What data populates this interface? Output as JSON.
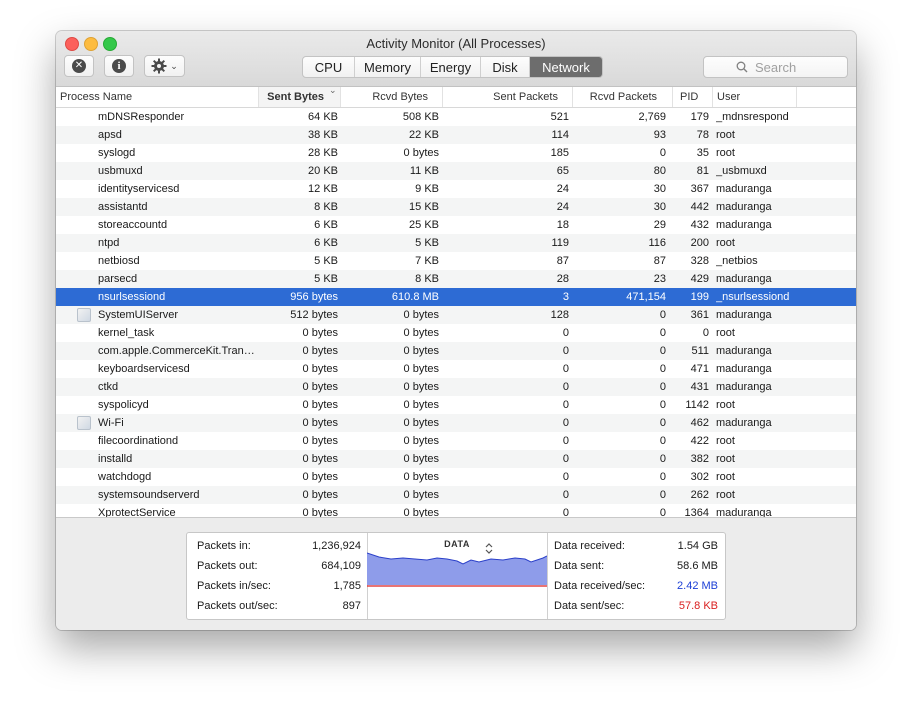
{
  "window": {
    "title": "Activity Monitor (All Processes)"
  },
  "toolbar": {
    "stop_icon": "x-circle-icon",
    "info_icon": "info-circle-icon",
    "gear_icon": "gear-icon",
    "tabs": [
      {
        "label": "CPU",
        "active": false
      },
      {
        "label": "Memory",
        "active": false
      },
      {
        "label": "Energy",
        "active": false
      },
      {
        "label": "Disk",
        "active": false
      },
      {
        "label": "Network",
        "active": true
      }
    ],
    "search_placeholder": "Search"
  },
  "table": {
    "columns": [
      "Process Name",
      "Sent Bytes",
      "Rcvd Bytes",
      "Sent Packets",
      "Rcvd Packets",
      "PID",
      "User"
    ],
    "sort_indicator": "⌄",
    "rows": [
      {
        "name": "mDNSResponder",
        "sent_bytes": "64 KB",
        "rcvd_bytes": "508 KB",
        "sent_packets": "521",
        "rcvd_packets": "2,769",
        "pid": "179",
        "user": "_mdnsrespond",
        "icon": false,
        "selected": false
      },
      {
        "name": "apsd",
        "sent_bytes": "38 KB",
        "rcvd_bytes": "22 KB",
        "sent_packets": "114",
        "rcvd_packets": "93",
        "pid": "78",
        "user": "root",
        "icon": false,
        "selected": false
      },
      {
        "name": "syslogd",
        "sent_bytes": "28 KB",
        "rcvd_bytes": "0 bytes",
        "sent_packets": "185",
        "rcvd_packets": "0",
        "pid": "35",
        "user": "root",
        "icon": false,
        "selected": false
      },
      {
        "name": "usbmuxd",
        "sent_bytes": "20 KB",
        "rcvd_bytes": "11 KB",
        "sent_packets": "65",
        "rcvd_packets": "80",
        "pid": "81",
        "user": "_usbmuxd",
        "icon": false,
        "selected": false
      },
      {
        "name": "identityservicesd",
        "sent_bytes": "12 KB",
        "rcvd_bytes": "9 KB",
        "sent_packets": "24",
        "rcvd_packets": "30",
        "pid": "367",
        "user": "maduranga",
        "icon": false,
        "selected": false
      },
      {
        "name": "assistantd",
        "sent_bytes": "8 KB",
        "rcvd_bytes": "15 KB",
        "sent_packets": "24",
        "rcvd_packets": "30",
        "pid": "442",
        "user": "maduranga",
        "icon": false,
        "selected": false
      },
      {
        "name": "storeaccountd",
        "sent_bytes": "6 KB",
        "rcvd_bytes": "25 KB",
        "sent_packets": "18",
        "rcvd_packets": "29",
        "pid": "432",
        "user": "maduranga",
        "icon": false,
        "selected": false
      },
      {
        "name": "ntpd",
        "sent_bytes": "6 KB",
        "rcvd_bytes": "5 KB",
        "sent_packets": "119",
        "rcvd_packets": "116",
        "pid": "200",
        "user": "root",
        "icon": false,
        "selected": false
      },
      {
        "name": "netbiosd",
        "sent_bytes": "5 KB",
        "rcvd_bytes": "7 KB",
        "sent_packets": "87",
        "rcvd_packets": "87",
        "pid": "328",
        "user": "_netbios",
        "icon": false,
        "selected": false
      },
      {
        "name": "parsecd",
        "sent_bytes": "5 KB",
        "rcvd_bytes": "8 KB",
        "sent_packets": "28",
        "rcvd_packets": "23",
        "pid": "429",
        "user": "maduranga",
        "icon": false,
        "selected": false
      },
      {
        "name": "nsurlsessiond",
        "sent_bytes": "956 bytes",
        "rcvd_bytes": "610.8 MB",
        "sent_packets": "3",
        "rcvd_packets": "471,154",
        "pid": "199",
        "user": "_nsurlsessiond",
        "icon": false,
        "selected": true
      },
      {
        "name": "SystemUIServer",
        "sent_bytes": "512 bytes",
        "rcvd_bytes": "0 bytes",
        "sent_packets": "128",
        "rcvd_packets": "0",
        "pid": "361",
        "user": "maduranga",
        "icon": true,
        "selected": false
      },
      {
        "name": "kernel_task",
        "sent_bytes": "0 bytes",
        "rcvd_bytes": "0 bytes",
        "sent_packets": "0",
        "rcvd_packets": "0",
        "pid": "0",
        "user": "root",
        "icon": false,
        "selected": false
      },
      {
        "name": "com.apple.CommerceKit.Tran…",
        "sent_bytes": "0 bytes",
        "rcvd_bytes": "0 bytes",
        "sent_packets": "0",
        "rcvd_packets": "0",
        "pid": "511",
        "user": "maduranga",
        "icon": false,
        "selected": false
      },
      {
        "name": "keyboardservicesd",
        "sent_bytes": "0 bytes",
        "rcvd_bytes": "0 bytes",
        "sent_packets": "0",
        "rcvd_packets": "0",
        "pid": "471",
        "user": "maduranga",
        "icon": false,
        "selected": false
      },
      {
        "name": "ctkd",
        "sent_bytes": "0 bytes",
        "rcvd_bytes": "0 bytes",
        "sent_packets": "0",
        "rcvd_packets": "0",
        "pid": "431",
        "user": "maduranga",
        "icon": false,
        "selected": false
      },
      {
        "name": "syspolicyd",
        "sent_bytes": "0 bytes",
        "rcvd_bytes": "0 bytes",
        "sent_packets": "0",
        "rcvd_packets": "0",
        "pid": "1142",
        "user": "root",
        "icon": false,
        "selected": false
      },
      {
        "name": "Wi-Fi",
        "sent_bytes": "0 bytes",
        "rcvd_bytes": "0 bytes",
        "sent_packets": "0",
        "rcvd_packets": "0",
        "pid": "462",
        "user": "maduranga",
        "icon": true,
        "selected": false
      },
      {
        "name": "filecoordinationd",
        "sent_bytes": "0 bytes",
        "rcvd_bytes": "0 bytes",
        "sent_packets": "0",
        "rcvd_packets": "0",
        "pid": "422",
        "user": "root",
        "icon": false,
        "selected": false
      },
      {
        "name": "installd",
        "sent_bytes": "0 bytes",
        "rcvd_bytes": "0 bytes",
        "sent_packets": "0",
        "rcvd_packets": "0",
        "pid": "382",
        "user": "root",
        "icon": false,
        "selected": false
      },
      {
        "name": "watchdogd",
        "sent_bytes": "0 bytes",
        "rcvd_bytes": "0 bytes",
        "sent_packets": "0",
        "rcvd_packets": "0",
        "pid": "302",
        "user": "root",
        "icon": false,
        "selected": false
      },
      {
        "name": "systemsoundserverd",
        "sent_bytes": "0 bytes",
        "rcvd_bytes": "0 bytes",
        "sent_packets": "0",
        "rcvd_packets": "0",
        "pid": "262",
        "user": "root",
        "icon": false,
        "selected": false
      },
      {
        "name": "XprotectService",
        "sent_bytes": "0 bytes",
        "rcvd_bytes": "0 bytes",
        "sent_packets": "0",
        "rcvd_packets": "0",
        "pid": "1364",
        "user": "maduranga",
        "icon": false,
        "selected": false
      }
    ]
  },
  "summary": {
    "packets_in_label": "Packets in:",
    "packets_in": "1,236,924",
    "packets_out_label": "Packets out:",
    "packets_out": "684,109",
    "packets_in_sec_label": "Packets in/sec:",
    "packets_in_sec": "1,785",
    "packets_out_sec_label": "Packets out/sec:",
    "packets_out_sec": "897",
    "graph_mode": "DATA",
    "graph_mode_icon": "up-down-chevron-icon",
    "data_received_label": "Data received:",
    "data_received": "1.54 GB",
    "data_sent_label": "Data sent:",
    "data_sent": "58.6 MB",
    "data_received_sec_label": "Data received/sec:",
    "data_received_sec": "2.42 MB",
    "data_sent_sec_label": "Data sent/sec:",
    "data_sent_sec": "57.8 KB",
    "received_color": "#1b3fd6",
    "sent_color": "#d92020",
    "graph_fill_color": "#8e9cea",
    "graph_line_color": "#2a3fc9"
  }
}
